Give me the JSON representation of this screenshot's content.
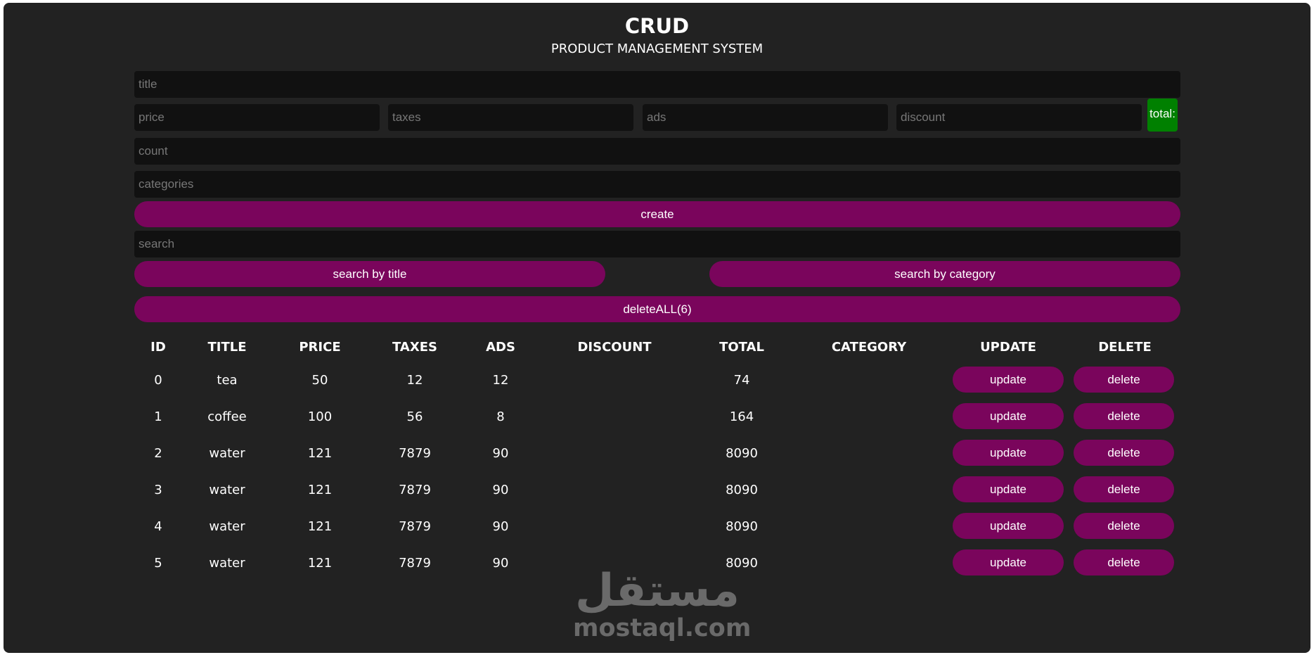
{
  "header": {
    "title": "CRUD",
    "subtitle": "PRODUCT MANAGEMENT SYSTEM"
  },
  "form": {
    "title_placeholder": "title",
    "price_placeholder": "price",
    "taxes_placeholder": "taxes",
    "ads_placeholder": "ads",
    "discount_placeholder": "discount",
    "total_label": "total:",
    "count_placeholder": "count",
    "categories_placeholder": "categories",
    "create_label": "create"
  },
  "search": {
    "placeholder": "search",
    "by_title_label": "search by title",
    "by_category_label": "search by category",
    "delete_all_label": "deleteALL(6)"
  },
  "table": {
    "headers": [
      "ID",
      "TITLE",
      "PRICE",
      "TAXES",
      "ADS",
      "DISCOUNT",
      "TOTAL",
      "CATEGORY",
      "UPDATE",
      "DELETE"
    ],
    "update_label": "update",
    "delete_label": "delete",
    "rows": [
      {
        "id": "0",
        "title": "tea",
        "price": "50",
        "taxes": "12",
        "ads": "12",
        "discount": "",
        "total": "74",
        "category": ""
      },
      {
        "id": "1",
        "title": "coffee",
        "price": "100",
        "taxes": "56",
        "ads": "8",
        "discount": "",
        "total": "164",
        "category": ""
      },
      {
        "id": "2",
        "title": "water",
        "price": "121",
        "taxes": "7879",
        "ads": "90",
        "discount": "",
        "total": "8090",
        "category": ""
      },
      {
        "id": "3",
        "title": "water",
        "price": "121",
        "taxes": "7879",
        "ads": "90",
        "discount": "",
        "total": "8090",
        "category": ""
      },
      {
        "id": "4",
        "title": "water",
        "price": "121",
        "taxes": "7879",
        "ads": "90",
        "discount": "",
        "total": "8090",
        "category": ""
      },
      {
        "id": "5",
        "title": "water",
        "price": "121",
        "taxes": "7879",
        "ads": "90",
        "discount": "",
        "total": "8090",
        "category": ""
      }
    ]
  },
  "watermark": {
    "arabic": "مستقل",
    "latin": "mostaql.com"
  },
  "colors": {
    "background": "#222222",
    "input": "#111111",
    "button": "#7a055c",
    "total": "#008000"
  }
}
